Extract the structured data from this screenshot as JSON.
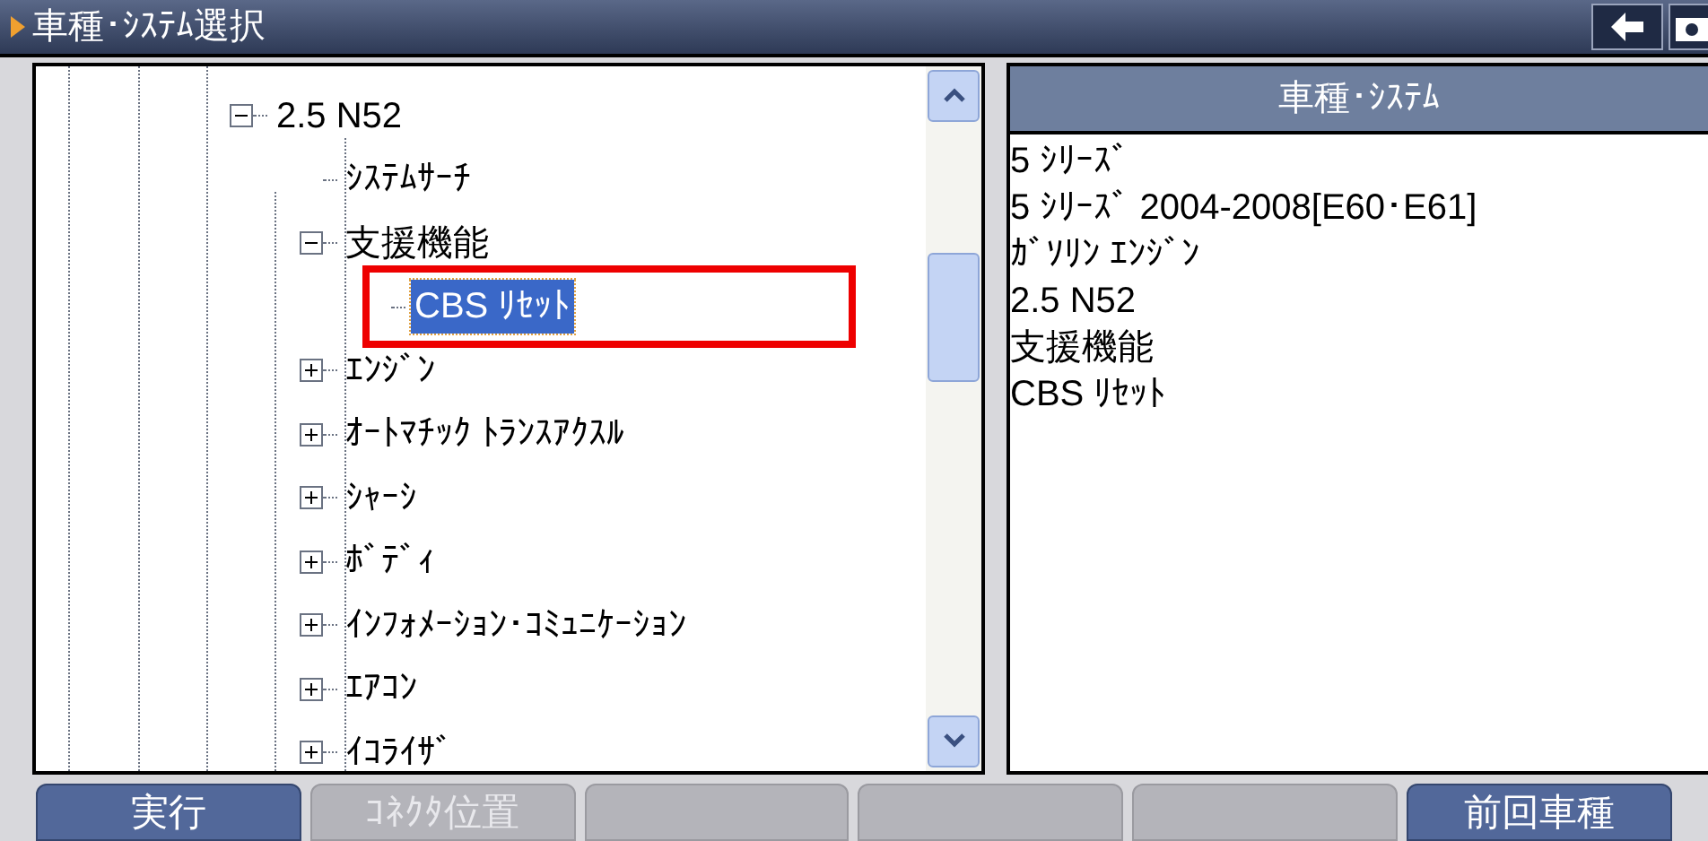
{
  "window": {
    "title": "車種･ｼｽﾃﾑ選択"
  },
  "tree": [
    {
      "label": "2.5 N52",
      "expanded": true,
      "selected": false,
      "highlighted": false,
      "children": [
        {
          "label": "ｼｽﾃﾑｻｰﾁ",
          "selected": false,
          "highlighted": false
        },
        {
          "label": "支援機能",
          "expanded": true,
          "selected": false,
          "highlighted": false,
          "children": [
            {
              "label": "CBS ﾘｾｯﾄ",
              "selected": true,
              "highlighted": true
            }
          ]
        },
        {
          "label": "ｴﾝｼﾞﾝ",
          "expanded": false,
          "selected": false,
          "highlighted": false
        },
        {
          "label": "ｵｰﾄﾏﾁｯｸ ﾄﾗﾝｽｱｸｽﾙ",
          "expanded": false,
          "selected": false,
          "highlighted": false
        },
        {
          "label": "ｼｬｰｼ",
          "expanded": false,
          "selected": false,
          "highlighted": false
        },
        {
          "label": "ﾎﾞﾃﾞｨ",
          "expanded": false,
          "selected": false,
          "highlighted": false
        },
        {
          "label": "ｲﾝﾌｫﾒｰｼｮﾝ･ｺﾐｭﾆｹｰｼｮﾝ",
          "expanded": false,
          "selected": false,
          "highlighted": false
        },
        {
          "label": "ｴｱｺﾝ",
          "expanded": false,
          "selected": false,
          "highlighted": false
        },
        {
          "label": "ｲｺﾗｲｻﾞ",
          "expanded": false,
          "selected": false,
          "highlighted": false
        }
      ]
    }
  ],
  "path_panel": {
    "header": "車種･ｼｽﾃﾑ",
    "lines": [
      "5 ｼﾘｰｽﾞ",
      "5 ｼﾘｰｽﾞ 2004-2008[E60･E61]",
      "ｶﾞｿﾘﾝ ｴﾝｼﾞﾝ",
      "2.5 N52",
      "支援機能",
      "CBS ﾘｾｯﾄ"
    ]
  },
  "buttons": [
    {
      "label": "実行",
      "disabled": false
    },
    {
      "label": "ｺﾈｸﾀ位置",
      "disabled": true
    },
    {
      "disabled": true
    },
    {
      "disabled": true
    },
    {
      "disabled": true
    },
    {
      "label": "前回車種",
      "disabled": false
    }
  ]
}
